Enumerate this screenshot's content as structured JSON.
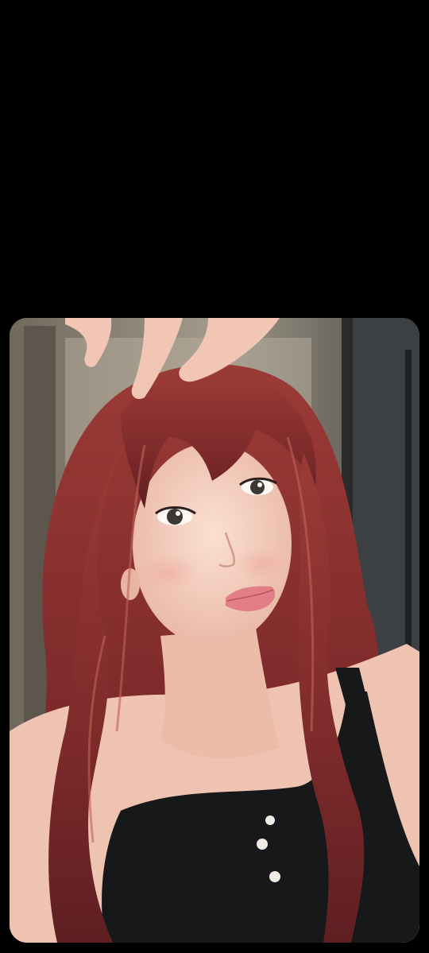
{
  "screen": {
    "background_color": "#000000"
  },
  "photo": {
    "subject": "portrait-photo",
    "colors": {
      "hair": "#8a2f2e",
      "hair_highlight": "#b8574d",
      "skin": "#f2cbbb",
      "top": "#16181a",
      "wall": "#8c8577",
      "window": "#3c4043"
    }
  }
}
